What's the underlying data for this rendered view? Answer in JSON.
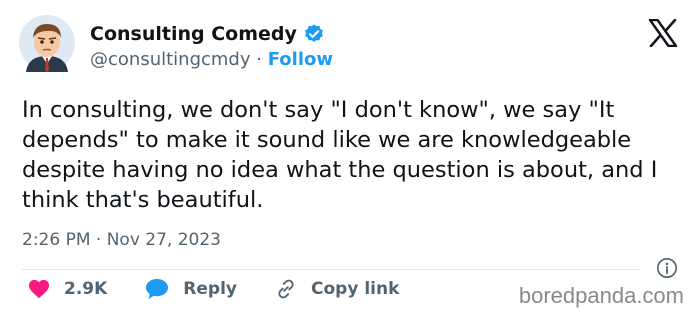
{
  "author": {
    "name": "Consulting Comedy",
    "handle": "@consultingcmdy",
    "separator": "·",
    "follow_label": "Follow"
  },
  "tweet": {
    "text": "In consulting, we don't say \"I don't know\", we say \"It depends\" to make it sound like we are knowledgeable despite having no idea what the question is about, and I think that's beautiful."
  },
  "meta": {
    "timestamp": "2:26 PM · Nov 27, 2023"
  },
  "actions": {
    "likes": "2.9K",
    "reply_label": "Reply",
    "copy_label": "Copy link"
  },
  "watermark": "boredpanda.com",
  "icons": {
    "verified": "verified-badge-icon",
    "x_logo": "x-logo-icon",
    "info": "info-icon",
    "heart": "heart-icon",
    "reply": "reply-bubble-icon",
    "link": "link-icon"
  },
  "colors": {
    "accent": "#1d9bf0",
    "like": "#f91880",
    "text": "#0f1419",
    "muted": "#536471"
  }
}
